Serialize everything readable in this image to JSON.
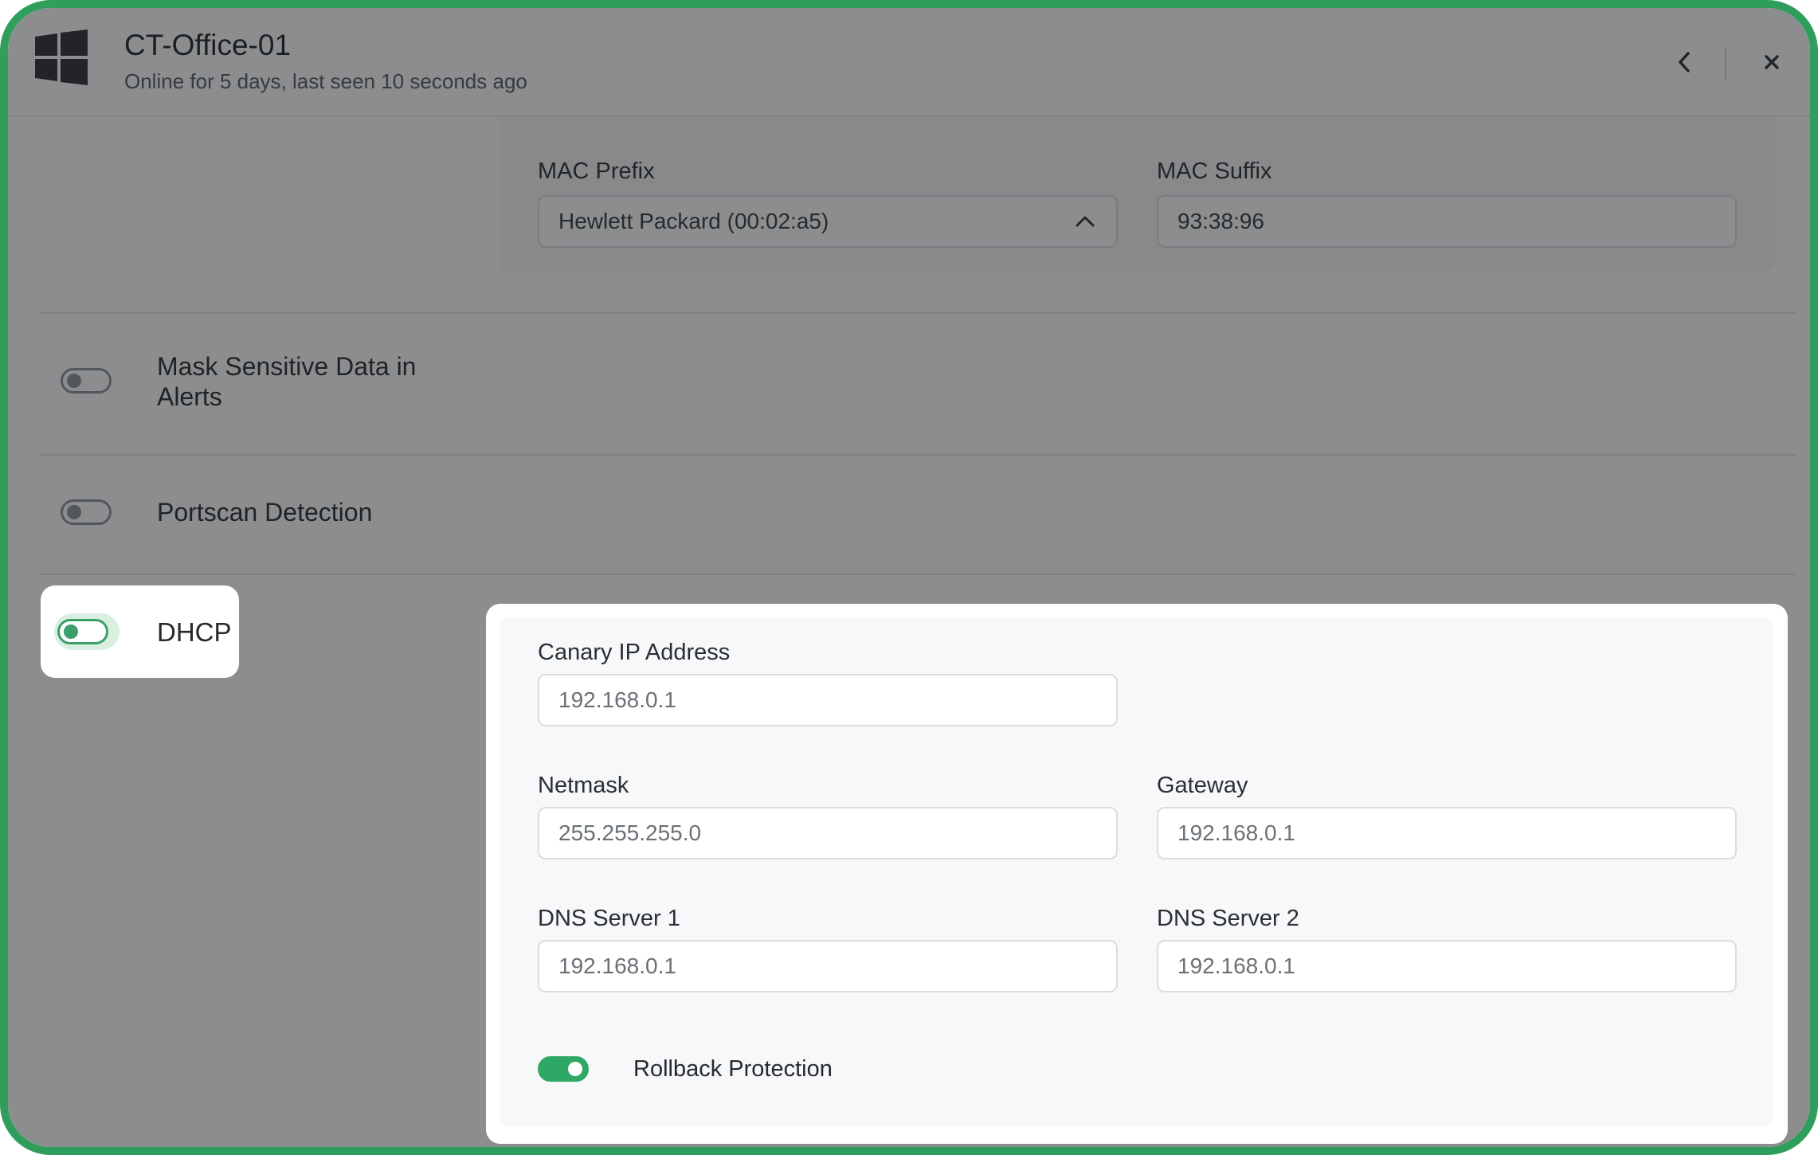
{
  "header": {
    "title": "CT-Office-01",
    "subtitle": "Online for 5 days, last seen 10 seconds ago",
    "os_icon": "windows-logo-icon",
    "back_icon": "chevron-left-icon",
    "close_icon": "close-icon"
  },
  "mac": {
    "prefix_label": "MAC Prefix",
    "prefix_value": "Hewlett Packard (00:02:a5)",
    "suffix_label": "MAC Suffix",
    "suffix_value": "93:38:96"
  },
  "settings": {
    "mask_label": "Mask Sensitive Data in Alerts",
    "portscan_label": "Portscan Detection",
    "dhcp_label": "DHCP"
  },
  "network": {
    "canary_ip_label": "Canary IP Address",
    "canary_ip_placeholder": "192.168.0.1",
    "netmask_label": "Netmask",
    "netmask_placeholder": "255.255.255.0",
    "gateway_label": "Gateway",
    "gateway_placeholder": "192.168.0.1",
    "dns1_label": "DNS Server 1",
    "dns1_placeholder": "192.168.0.1",
    "dns2_label": "DNS Server 2",
    "dns2_placeholder": "192.168.0.1",
    "rollback_label": "Rollback Protection"
  },
  "colors": {
    "frame": "#2f9e5c",
    "toggle_on": "#2fa866",
    "dim_overlay": "rgba(25,27,29,0.5)"
  }
}
